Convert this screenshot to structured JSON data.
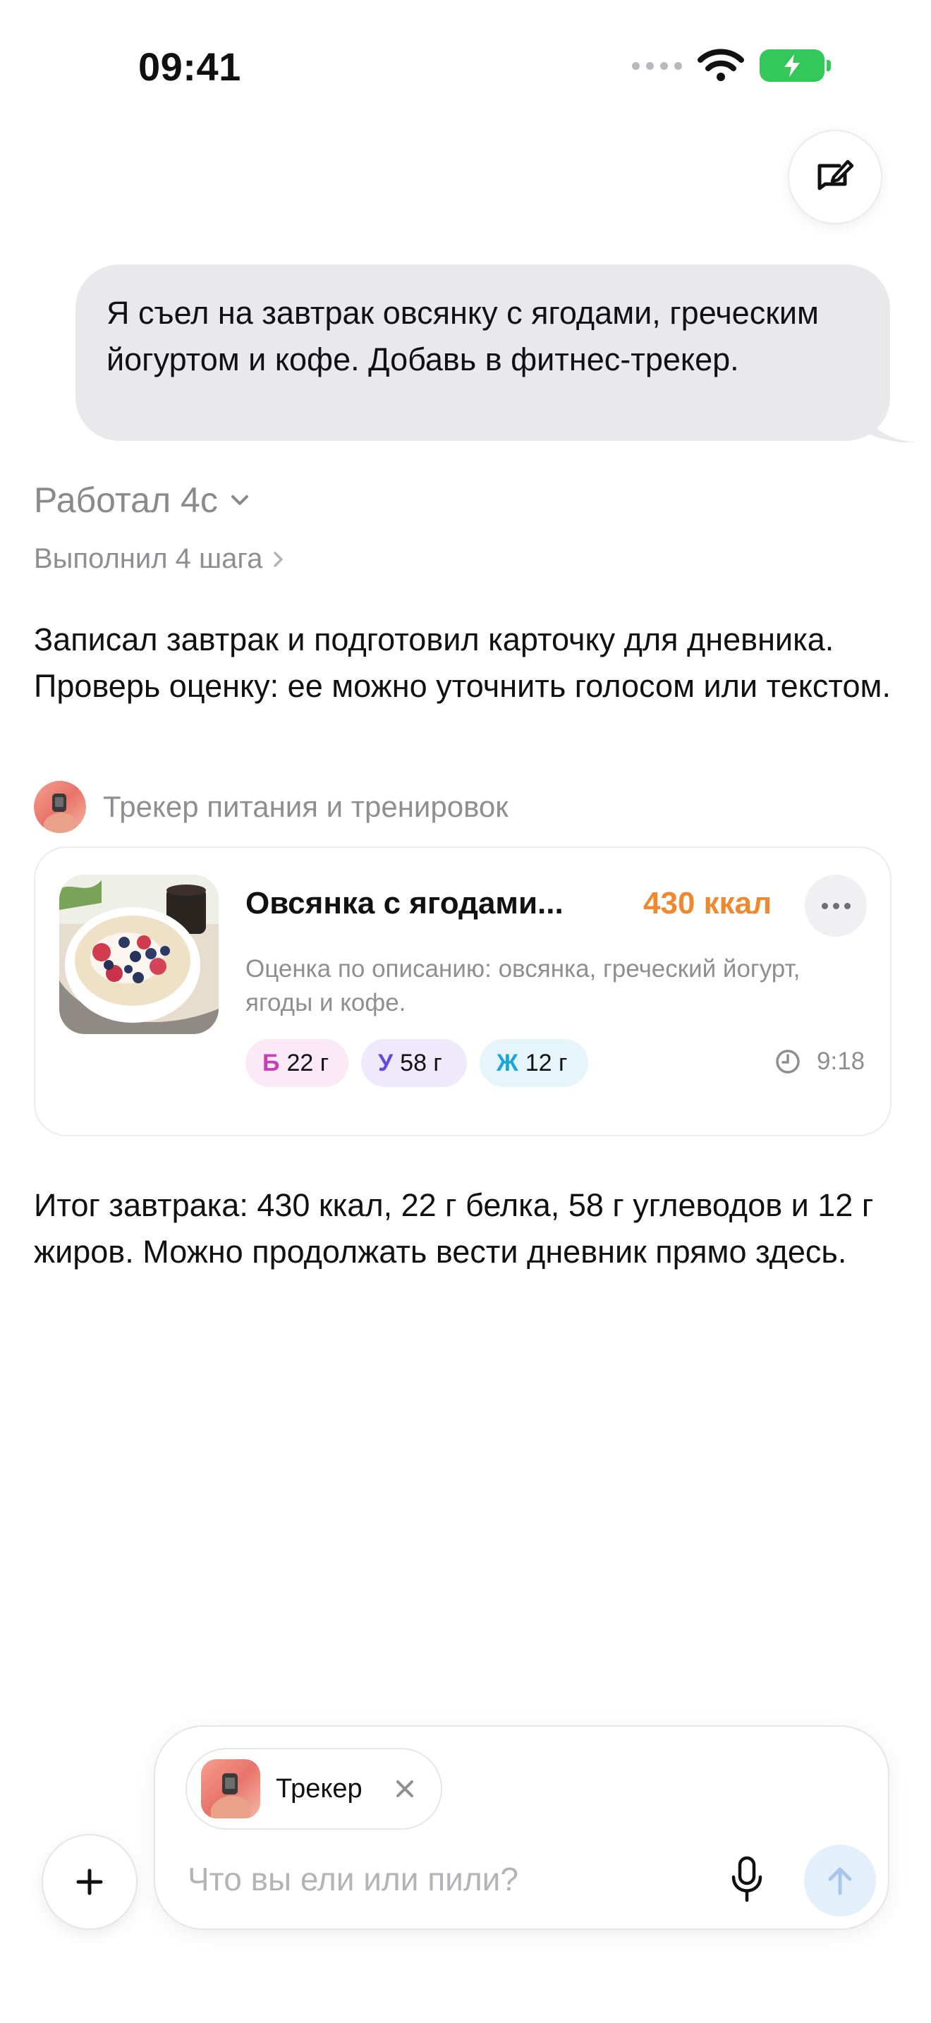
{
  "status_bar": {
    "time": "09:41"
  },
  "chat": {
    "user_message": "Я съел на завтрак овсянку с ягодами, греческим йогуртом и кофе. Добавь в фитнес-трекер.",
    "worked_label": "Работал 4с",
    "steps_label": "Выполнил 4 шага",
    "reply_intro": "Записал завтрак и подготовил карточку для дневника. Проверь оценку: ее можно уточнить голосом или текстом.",
    "tracker_name": "Трекер питания и тренировок",
    "reply_summary": "Итог завтрака: 430 ккал, 22 г белка, 58 г углеводов и 12 г жиров. Можно продолжать вести дневник прямо здесь."
  },
  "food_card": {
    "title": "Овсянка с ягодами...",
    "kcal": "430 ккал",
    "description": "Оценка по описанию: овсянка, греческий йогурт, ягоды и кофе.",
    "macros": {
      "protein": {
        "key": "Б",
        "value": "22 г"
      },
      "carbs": {
        "key": "У",
        "value": "58 г"
      },
      "fat": {
        "key": "Ж",
        "value": "12 г"
      }
    },
    "time": "9:18"
  },
  "composer": {
    "chip_label": "Трекер",
    "placeholder": "Что вы ели или пили?"
  },
  "colors": {
    "kcal": "#f0882e",
    "protein": "#c83fb5",
    "carbs": "#6548e0",
    "fat": "#1ea5d7",
    "battery": "#34c759"
  },
  "icons": [
    "wifi-icon",
    "battery-icon",
    "compose-icon",
    "chevron-down-icon",
    "chevron-right-icon",
    "more-icon",
    "clock-icon",
    "plus-icon",
    "close-icon",
    "microphone-icon",
    "arrow-up-icon"
  ]
}
